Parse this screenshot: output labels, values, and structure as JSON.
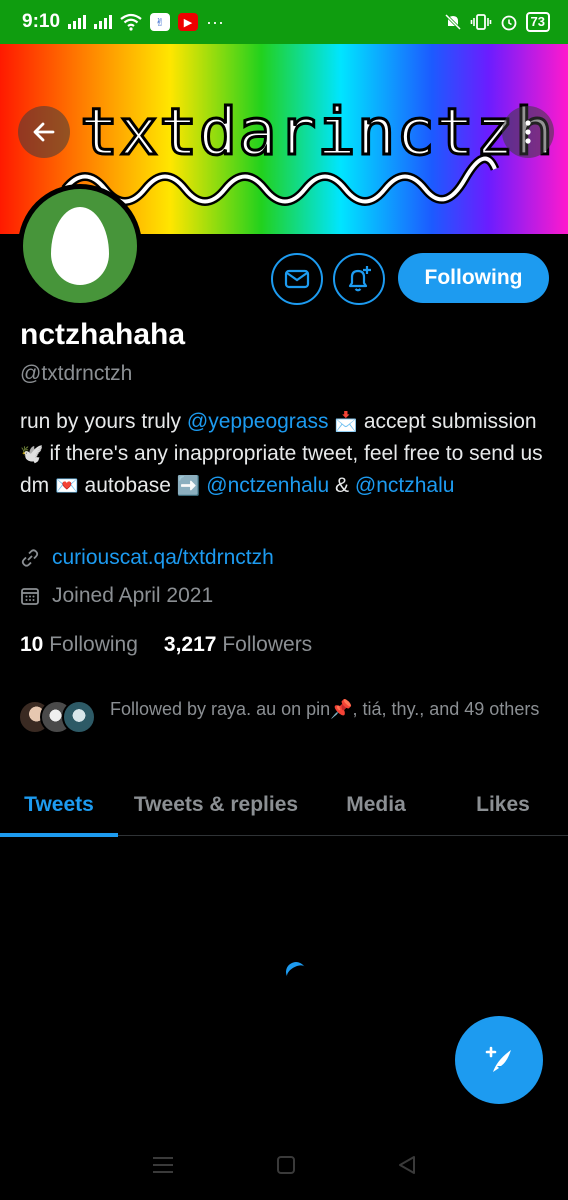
{
  "status_bar": {
    "time": "9:10",
    "battery": "73",
    "more": "···"
  },
  "banner": {
    "text": "txtdarinctzh"
  },
  "profile": {
    "display_name": "nctzhahaha",
    "handle": "@txtdrnctzh",
    "following_button": "Following"
  },
  "bio": {
    "part1": "run by yours truly ",
    "mention1": "@yeppeograss",
    "emoji1": "📩",
    "part2": " accept submission ",
    "emoji2": "🕊️",
    "part3": " if there's any inappropriate tweet, feel free to send us dm ",
    "emoji3": "💌",
    "part4": " autobase ",
    "emoji4": "➡️",
    "mention2": "@nctzenhalu",
    "part5": " & ",
    "mention3": "@nctzhalu"
  },
  "meta": {
    "website": "curiouscat.qa/txtdrnctzh",
    "joined": "Joined April 2021"
  },
  "counts": {
    "following_count": "10",
    "following_label": "Following",
    "followers_count": "3,217",
    "followers_label": "Followers"
  },
  "followed_by": "Followed by raya. au on pin📌, tiá, thy., and 49 others",
  "tabs": [
    {
      "label": "Tweets",
      "active": true
    },
    {
      "label": "Tweets & replies",
      "active": false
    },
    {
      "label": "Media",
      "active": false
    },
    {
      "label": "Likes",
      "active": false
    }
  ],
  "colors": {
    "accent": "#1d9bf0",
    "status_bar": "#0f9d0f",
    "avatar_bg": "#47953a",
    "background": "#000000"
  },
  "icons": [
    "back-arrow-icon",
    "more-vertical-icon",
    "mail-icon",
    "bell-plus-icon",
    "link-icon",
    "calendar-icon",
    "compose-feather-icon",
    "menu-icon",
    "home-square-icon",
    "back-triangle-icon"
  ]
}
